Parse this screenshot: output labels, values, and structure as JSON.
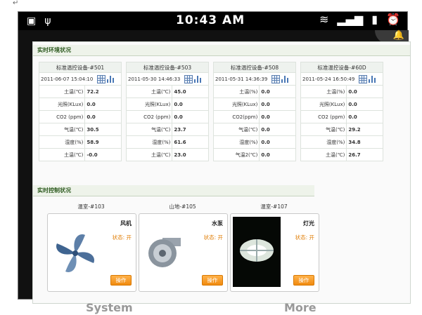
{
  "statusbar": {
    "time": "10:43 AM"
  },
  "corner_mark": "↵",
  "env_section": {
    "title": "实时环境状况"
  },
  "devices": [
    {
      "name": "标准温控设备-#501",
      "time": "2011-06-07 15:04:10",
      "rows": [
        [
          "土温(℃)",
          "72.2"
        ],
        [
          "光照(KLux)",
          "0.0"
        ],
        [
          "CO2 (ppm)",
          "0.0"
        ],
        [
          "气温(℃)",
          "30.5"
        ],
        [
          "湿度(%)",
          "58.9"
        ],
        [
          "土温(℃)",
          "-0.0"
        ]
      ]
    },
    {
      "name": "标准温控设备-#503",
      "time": "2011-05-30 14:46:33",
      "rows": [
        [
          "土温(℃)",
          "45.0"
        ],
        [
          "光照(KLux)",
          "0.0"
        ],
        [
          "CO2 (ppm)",
          "0.0"
        ],
        [
          "气温(℃)",
          "23.7"
        ],
        [
          "湿度(%)",
          "61.6"
        ],
        [
          "土温(℃)",
          "23.0"
        ]
      ]
    },
    {
      "name": "标准温控设备-#508",
      "time": "2011-05-31 14:36:39",
      "rows": [
        [
          "土温(%)",
          "0.0"
        ],
        [
          "光照(KLux)",
          "0.0"
        ],
        [
          "CO2(ppm)",
          "0.0"
        ],
        [
          "气温(℃)",
          "0.0"
        ],
        [
          "湿度(%)",
          "0.0"
        ],
        [
          "气温2(℃)",
          "0.0"
        ]
      ]
    },
    {
      "name": "标准温控设备-#60D",
      "time": "2011-05-24 16:50:49",
      "rows": [
        [
          "土温(%)",
          "0.0"
        ],
        [
          "光照(KLux)",
          "0.0"
        ],
        [
          "CO2 (ppm)",
          "0.0"
        ],
        [
          "气温(℃)",
          "29.2"
        ],
        [
          "湿度(%)",
          "34.8"
        ],
        [
          "土温(℃)",
          "26.7"
        ]
      ]
    }
  ],
  "control_section": {
    "title": "实时控制状况"
  },
  "controls": [
    {
      "caption": "温室-#103",
      "name": "风机",
      "state": "状态: 开",
      "button": "操作",
      "icon": "fan-icon"
    },
    {
      "caption": "山地-#105",
      "name": "水泵",
      "state": "状态: 开",
      "button": "操作",
      "icon": "pump-icon"
    },
    {
      "caption": "温室-#107",
      "name": "灯光",
      "state": "状态: 开",
      "button": "操作",
      "icon": "lamp-icon"
    }
  ],
  "behind": {
    "left": "System",
    "right": "More"
  }
}
